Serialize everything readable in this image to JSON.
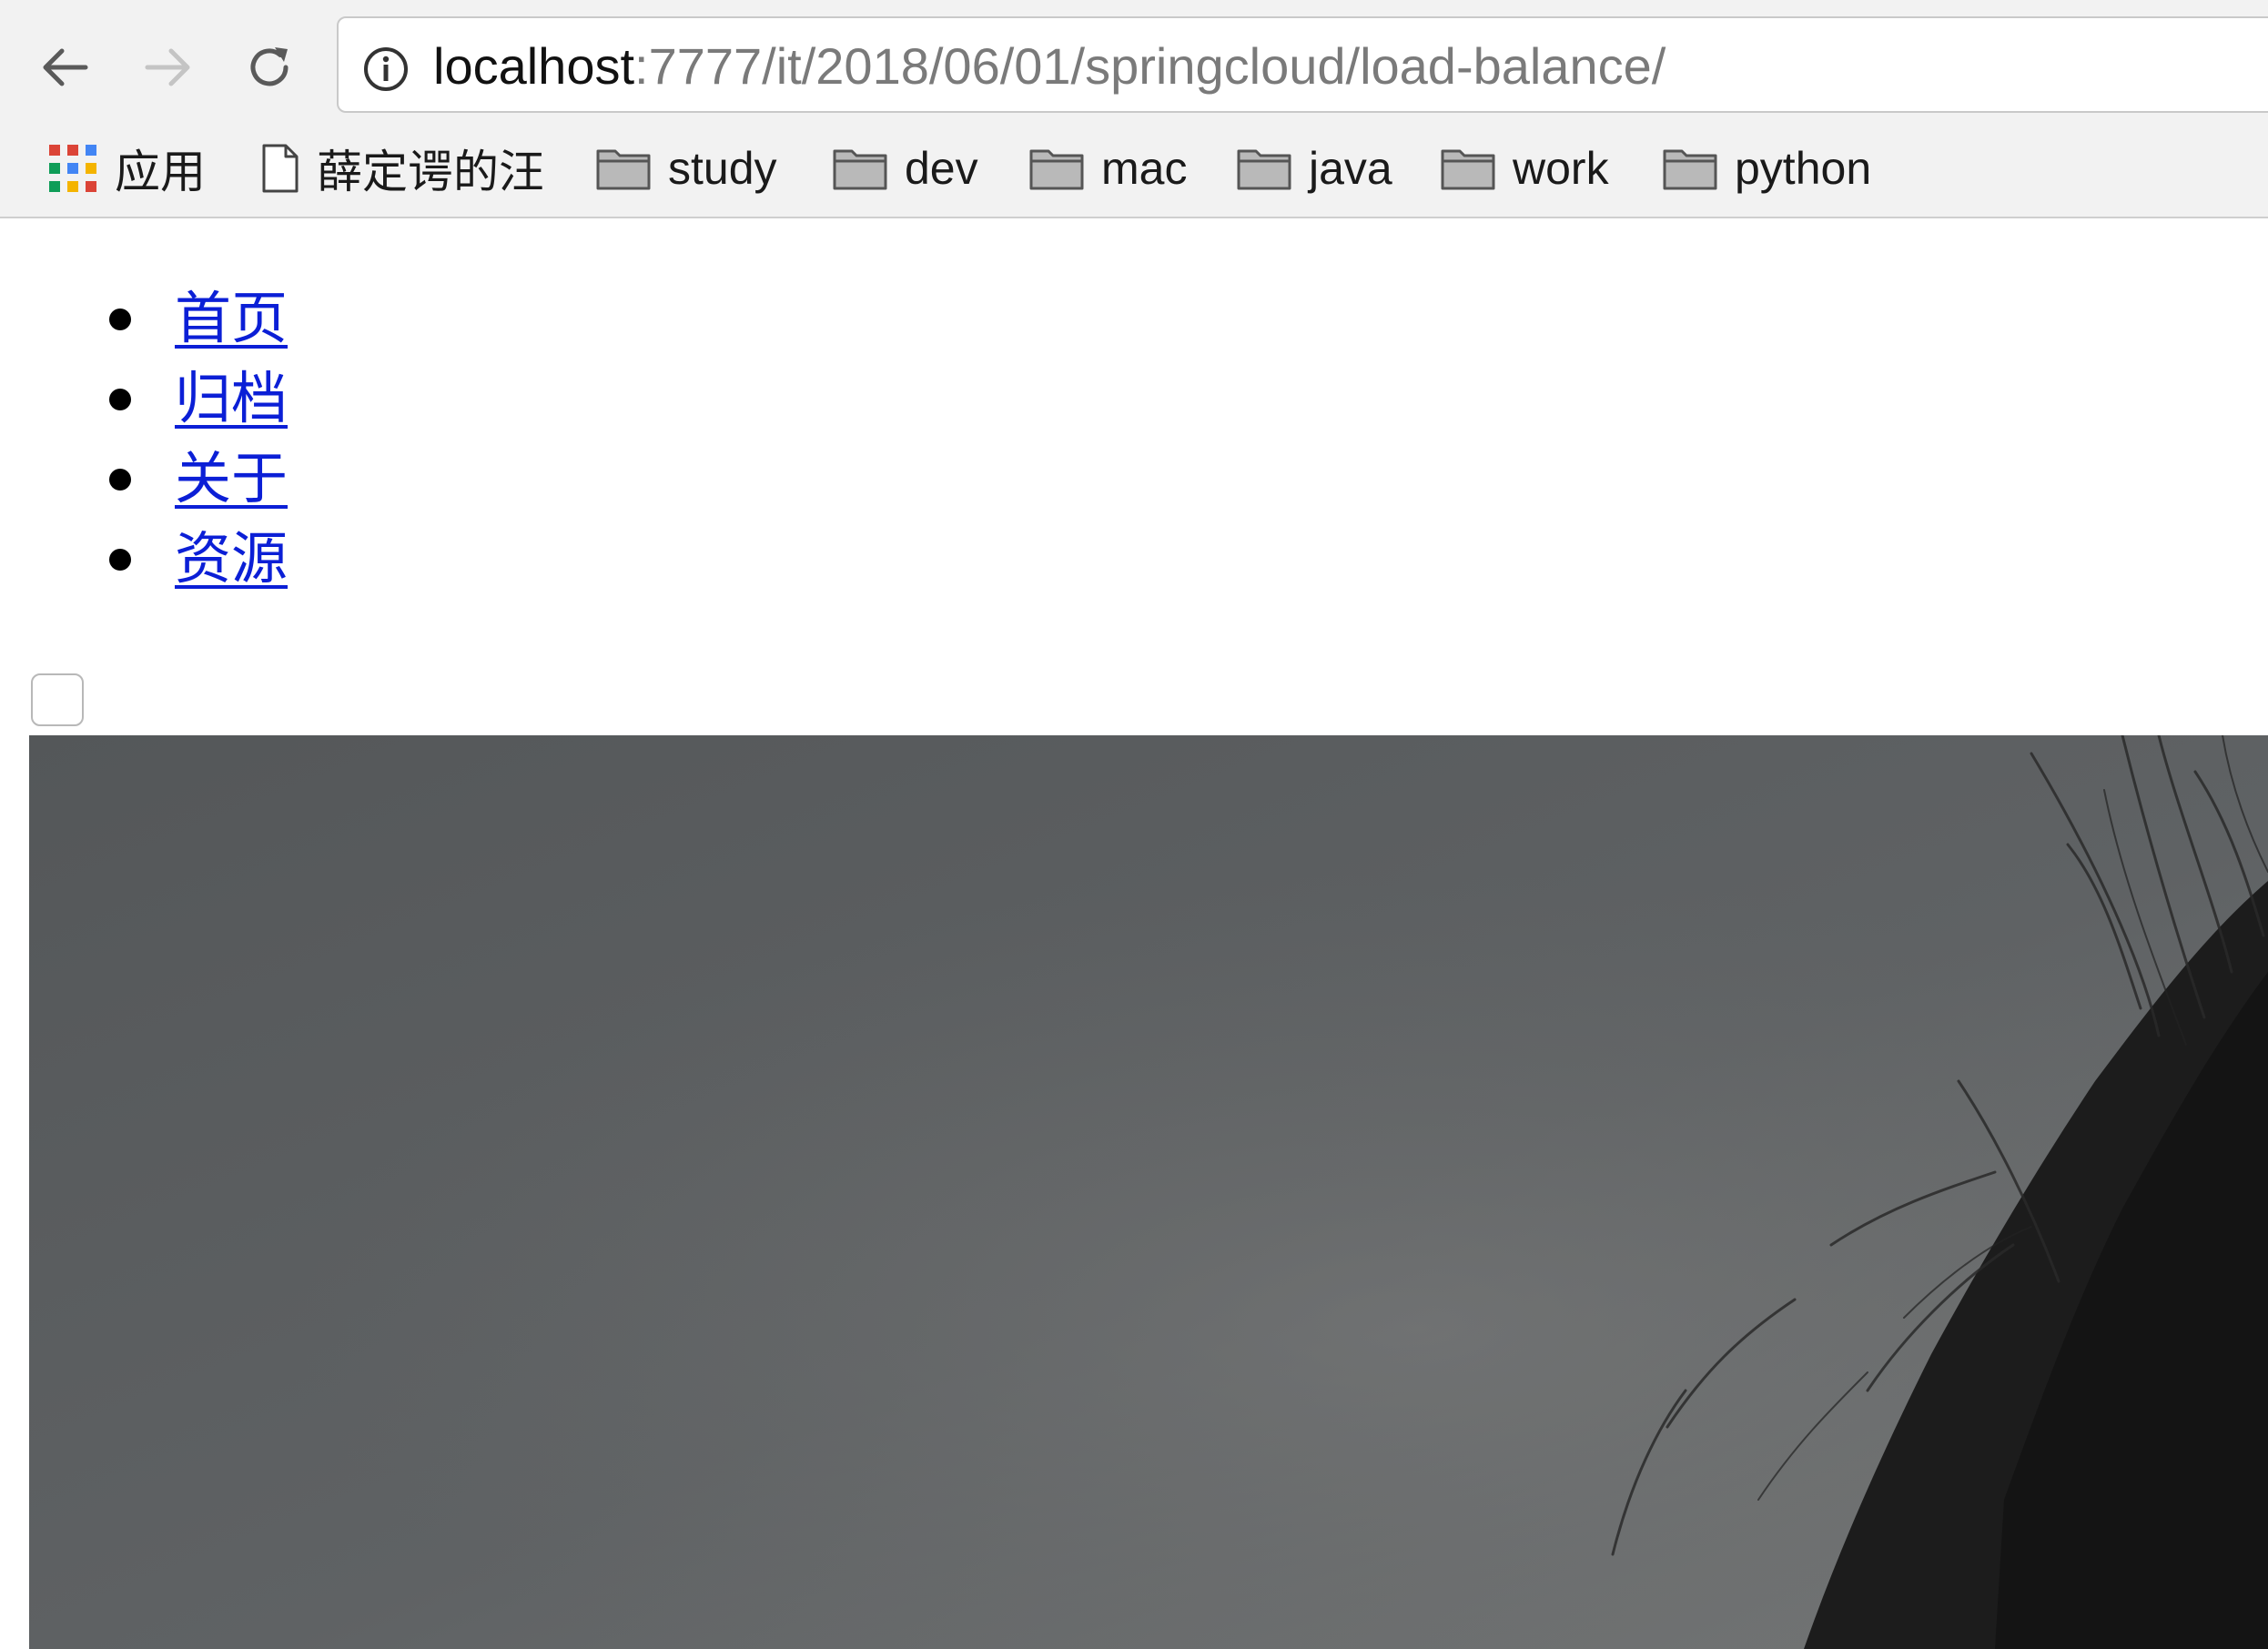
{
  "browser": {
    "url_host": "localhost",
    "url_path": ":7777/it/2018/06/01/springcloud/load-balance/",
    "nav_icons": [
      "back-arrow-icon",
      "forward-arrow-icon",
      "reload-icon",
      "info-icon"
    ],
    "bookmarks": [
      {
        "label": "应用",
        "icon": "apps-grid-icon"
      },
      {
        "label": "薛定谔的汪",
        "icon": "page-icon"
      },
      {
        "label": "study",
        "icon": "folder-icon"
      },
      {
        "label": "dev",
        "icon": "folder-icon"
      },
      {
        "label": "mac",
        "icon": "folder-icon"
      },
      {
        "label": "java",
        "icon": "folder-icon"
      },
      {
        "label": "work",
        "icon": "folder-icon"
      },
      {
        "label": "python",
        "icon": "folder-icon"
      }
    ]
  },
  "page": {
    "nav_items": [
      {
        "label": "首页"
      },
      {
        "label": "归档"
      },
      {
        "label": "关于"
      },
      {
        "label": "资源"
      }
    ],
    "checkbox_checked": false,
    "hero_image": "grayscale-portrait-photo"
  },
  "colors": {
    "link": "#0b1fd6",
    "chrome_bg": "#f2f2f2",
    "photo_bg": "#5e6163",
    "hair": "#1b1b1b"
  }
}
